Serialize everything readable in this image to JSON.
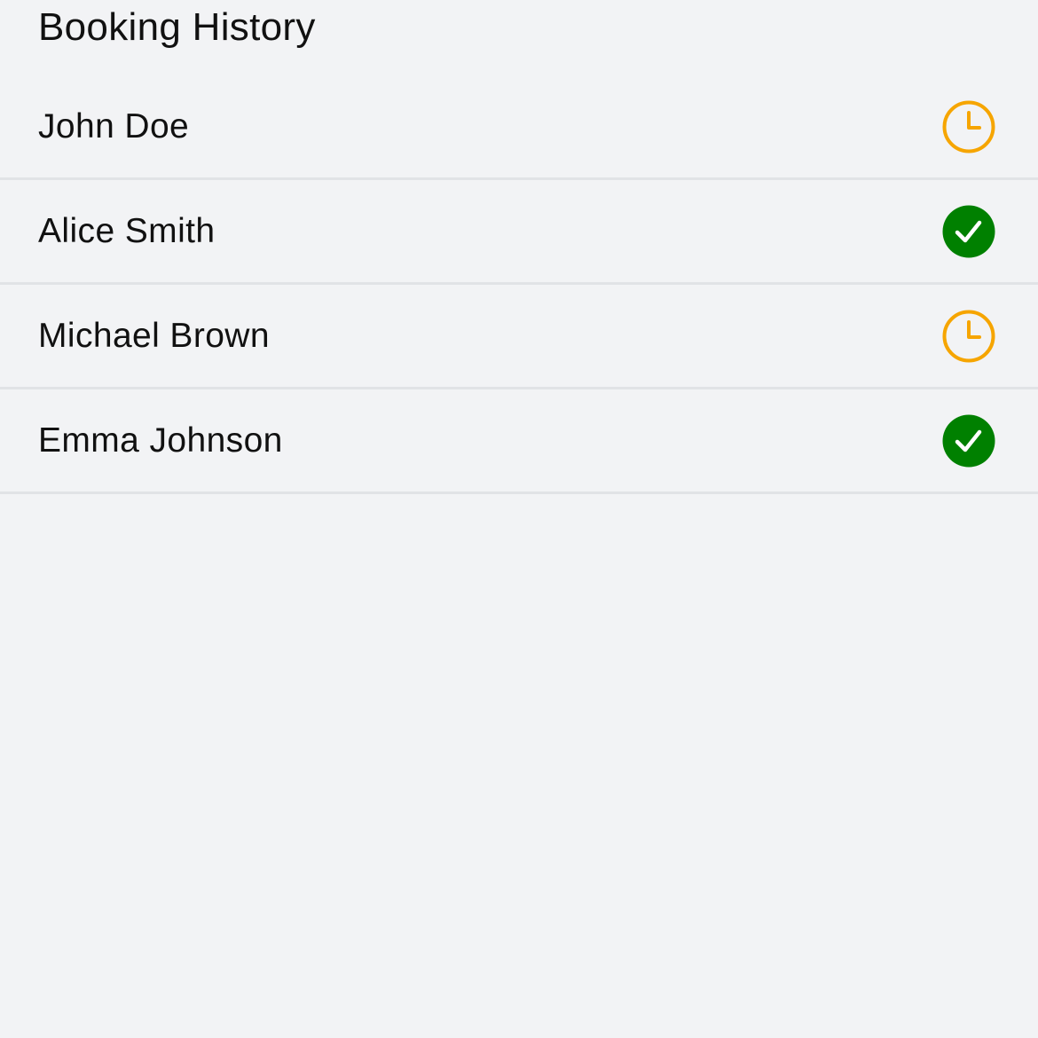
{
  "page": {
    "title": "Booking History",
    "background": "#f2f3f5"
  },
  "colors": {
    "pending": "#f6a500",
    "confirmed": "#008000",
    "divider": "#e1e3e6"
  },
  "bookings": [
    {
      "name": "John Doe",
      "status": "pending",
      "icon": "clock-icon"
    },
    {
      "name": "Alice Smith",
      "status": "confirmed",
      "icon": "checkmark-circle-icon"
    },
    {
      "name": "Michael Brown",
      "status": "pending",
      "icon": "clock-icon"
    },
    {
      "name": "Emma Johnson",
      "status": "confirmed",
      "icon": "checkmark-circle-icon"
    }
  ]
}
